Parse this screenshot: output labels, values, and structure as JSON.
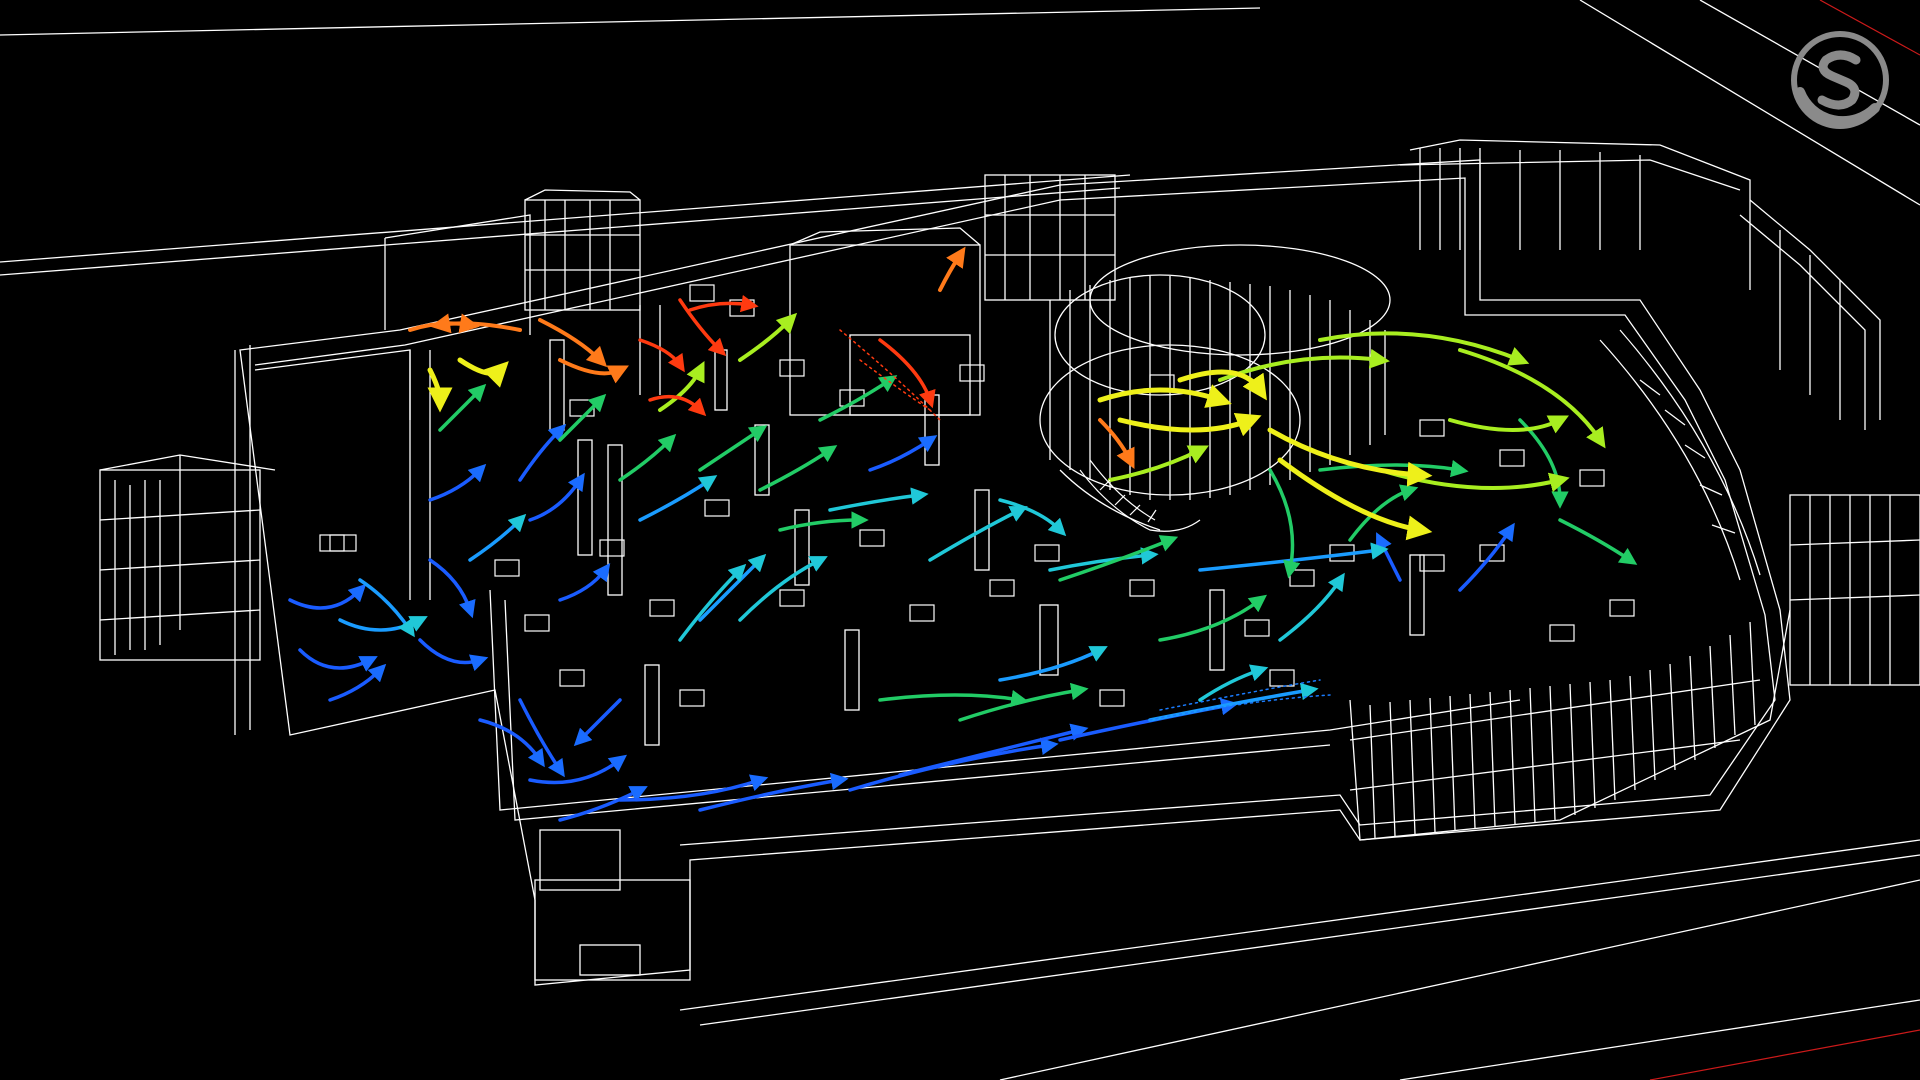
{
  "scene": {
    "background_color": "#000000",
    "wireframe_color": "#ffffff",
    "accent_line_color": "#cc1a1a",
    "visualization": "velocity-streamlines",
    "colormap": [
      "#1030ff",
      "#1a8cff",
      "#20c8d8",
      "#22cc77",
      "#8ae11c",
      "#e8ee1a",
      "#ff8a1a",
      "#ff3a10"
    ]
  },
  "logo": {
    "icon": "s-badge-icon",
    "color": "#8a8a8a"
  },
  "toolbar": {}
}
